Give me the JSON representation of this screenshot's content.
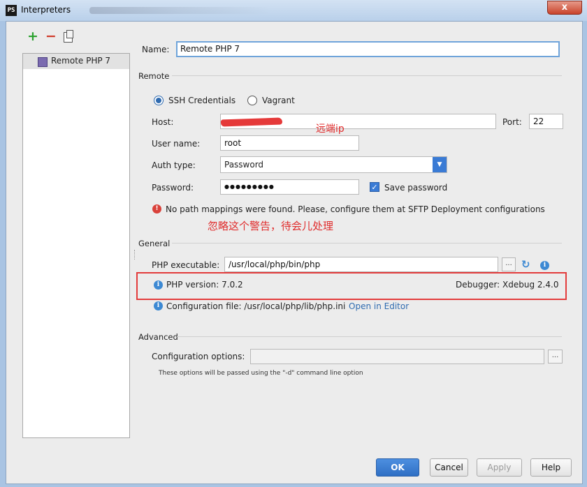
{
  "window": {
    "title": "Interpreters",
    "title_icon": "PS",
    "close_label": "x"
  },
  "toolbar": {
    "add": "+",
    "remove": "−"
  },
  "interpreters": [
    {
      "label": "Remote PHP 7"
    }
  ],
  "name_field": {
    "label": "Name:",
    "value": "Remote PHP 7"
  },
  "remote": {
    "section": "Remote",
    "ssh_label": "SSH Credentials",
    "vagrant_label": "Vagrant",
    "selected": "SSH Credentials",
    "host_label": "Host:",
    "host_value": "",
    "port_label": "Port:",
    "port_value": "22",
    "user_label": "User name:",
    "user_value": "root",
    "auth_label": "Auth type:",
    "auth_value": "Password",
    "password_label": "Password:",
    "password_value": "●●●●●●●●●",
    "save_password_label": "Save password",
    "save_password_checked": true,
    "warning": "No path mappings were found. Please, configure them at SFTP Deployment configurations"
  },
  "annotations": {
    "remote_ip": "远端ip",
    "ignore_warning": "忽略这个警告，待会儿处理"
  },
  "general": {
    "section": "General",
    "executable_label": "PHP executable:",
    "executable_value": "/usr/local/php/bin/php",
    "version_text": "PHP version: 7.0.2",
    "debugger_text": "Debugger: Xdebug 2.4.0",
    "config_file_text": "Configuration file: /usr/local/php/lib/php.ini",
    "open_in_editor": "Open in Editor",
    "browse_label": "...",
    "info_glyph": "i"
  },
  "advanced": {
    "section": "Advanced",
    "config_options_label": "Configuration options:",
    "config_options_value": "",
    "hint": "These options will be passed using the \"-d\" command line option",
    "browse_label": "..."
  },
  "buttons": {
    "ok": "OK",
    "cancel": "Cancel",
    "apply": "Apply",
    "help": "Help"
  },
  "colors": {
    "accent": "#3a7bd5",
    "annotation": "#e02b2b",
    "error": "#d9413a",
    "info": "#3d89d3"
  }
}
